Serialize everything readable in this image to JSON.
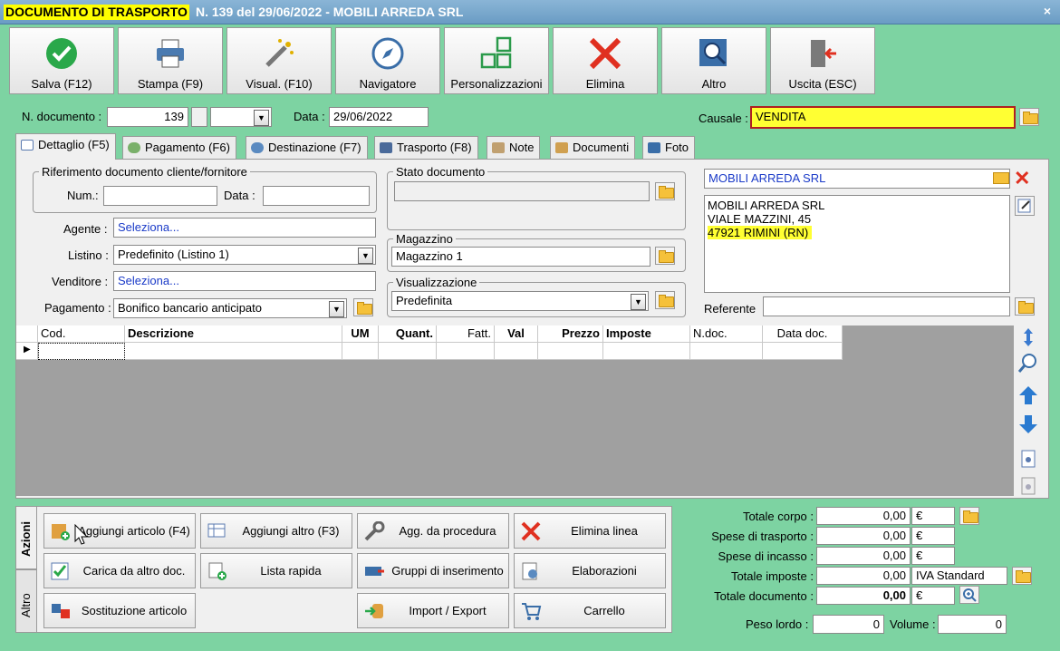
{
  "window": {
    "title_highlight": "DOCUMENTO DI TRASPORTO",
    "title_rest": "N. 139 del 29/06/2022 - MOBILI ARREDA SRL",
    "close": "×"
  },
  "toolbar": {
    "save": "Salva (F12)",
    "print": "Stampa (F9)",
    "view": "Visual. (F10)",
    "navigator": "Navigatore",
    "customize": "Personalizzazioni",
    "delete": "Elimina",
    "other": "Altro",
    "exit": "Uscita (ESC)"
  },
  "header": {
    "doc_num_label": "N. documento :",
    "doc_num_value": "139",
    "date_label": "Data :",
    "date_value": "29/06/2022",
    "causale_label": "Causale :",
    "causale_value": "VENDITA"
  },
  "tabs": [
    "Dettaglio (F5)",
    "Pagamento (F6)",
    "Destinazione (F7)",
    "Trasporto (F8)",
    "Note",
    "Documenti",
    "Foto"
  ],
  "ref": {
    "legend": "Riferimento documento cliente/fornitore",
    "num_label": "Num.:",
    "num_value": "",
    "date_label": "Data :",
    "date_value": ""
  },
  "form": {
    "agent_label": "Agente :",
    "agent_value": "Seleziona...",
    "list_label": "Listino :",
    "list_value": "Predefinito (Listino 1)",
    "seller_label": "Venditore :",
    "seller_value": "Seleziona...",
    "payment_label": "Pagamento :",
    "payment_value": "Bonifico bancario anticipato"
  },
  "status": {
    "legend": "Stato documento",
    "value": ""
  },
  "warehouse": {
    "legend": "Magazzino",
    "value": "Magazzino 1"
  },
  "display": {
    "legend": "Visualizzazione",
    "value": "Predefinita"
  },
  "customer": {
    "name": "MOBILI ARREDA SRL",
    "line1": "MOBILI ARREDA SRL",
    "line2": "VIALE MAZZINI, 45",
    "line3": "47921 RIMINI (RN)",
    "referent_label": "Referente",
    "referent_value": ""
  },
  "grid": {
    "columns": [
      "Cod.",
      "Descrizione",
      "UM",
      "Quant.",
      "Fatt.",
      "Val",
      "Prezzo",
      "Imposte",
      "N.doc.",
      "Data doc."
    ]
  },
  "side_tabs": {
    "actions": "Azioni",
    "other": "Altro"
  },
  "actions": {
    "add_article": "Aggiungi articolo (F4)",
    "add_other": "Aggiungi altro (F3)",
    "add_from_proc": "Agg. da procedura",
    "delete_line": "Elimina linea",
    "load_doc": "Carica da altro doc.",
    "quick_list": "Lista rapida",
    "insert_groups": "Gruppi di inserimento",
    "processing": "Elaborazioni",
    "replace_article": "Sostituzione articolo",
    "import_export": "Import / Export",
    "cart": "Carrello"
  },
  "totals": {
    "body_label": "Totale corpo :",
    "body_value": "0,00",
    "body_cur": "€",
    "shipping_label": "Spese di trasporto :",
    "shipping_value": "0,00",
    "shipping_cur": "€",
    "collection_label": "Spese di incasso :",
    "collection_value": "0,00",
    "collection_cur": "€",
    "tax_label": "Totale imposte :",
    "tax_value": "0,00",
    "tax_type": "IVA Standard",
    "doc_label": "Totale documento :",
    "doc_value": "0,00",
    "doc_cur": "€",
    "weight_label": "Peso lordo :",
    "weight_value": "0",
    "volume_label": "Volume :",
    "volume_value": "0"
  }
}
